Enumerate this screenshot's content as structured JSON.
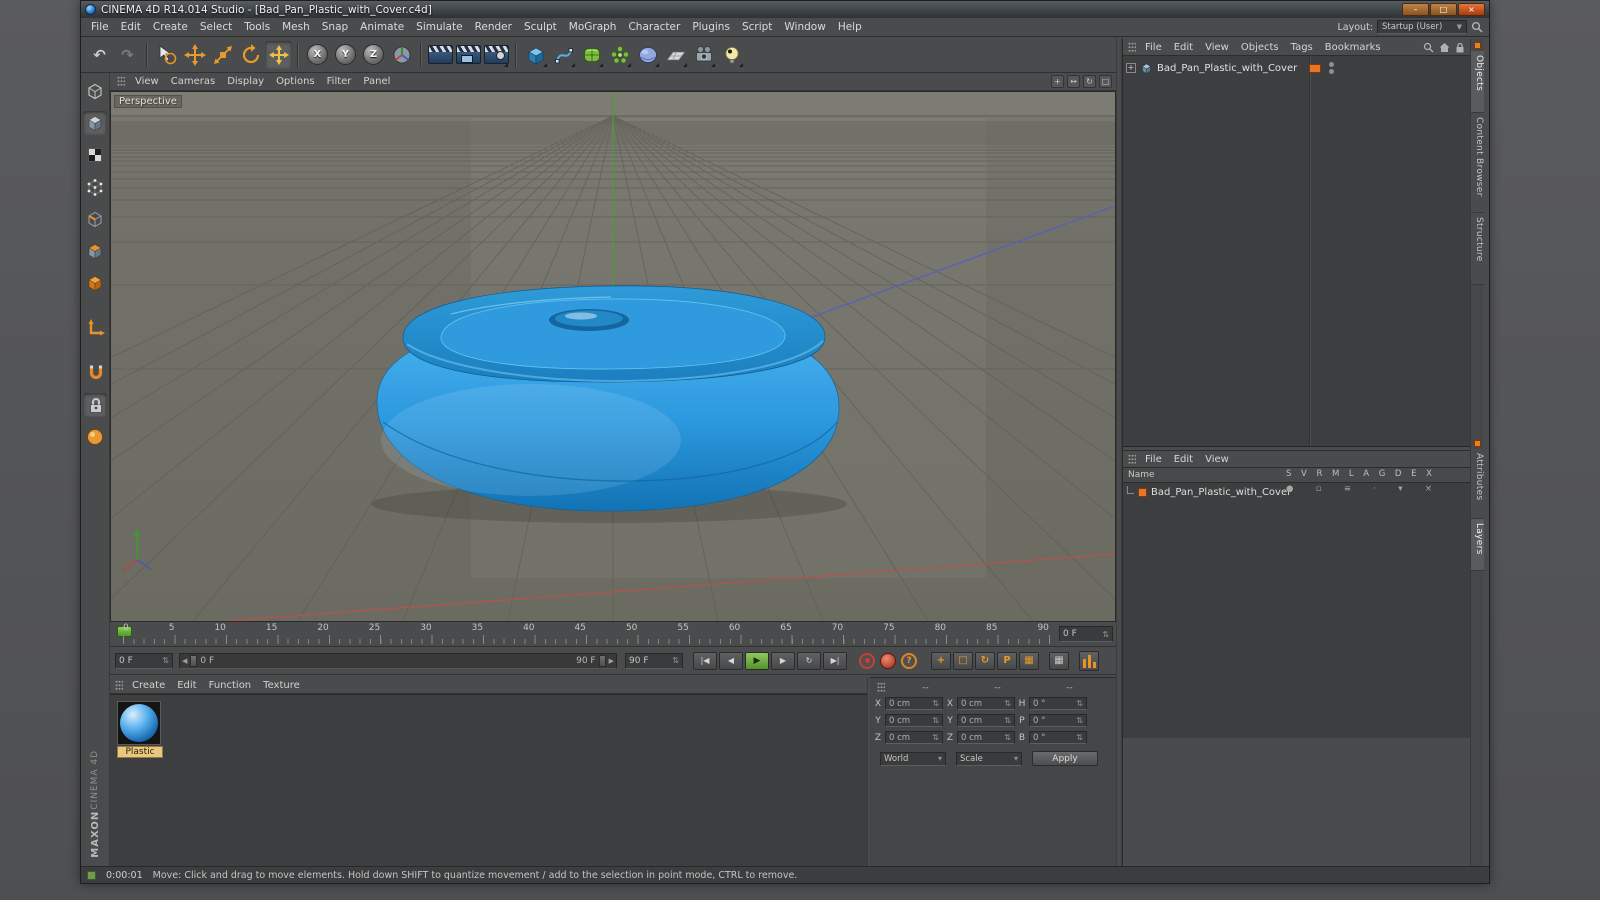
{
  "window": {
    "title": "CINEMA 4D R14.014 Studio - [Bad_Pan_Plastic_with_Cover.c4d]",
    "controls": {
      "minimize": "–",
      "maximize": "□",
      "close": "×"
    }
  },
  "menubar": {
    "items": [
      "File",
      "Edit",
      "Create",
      "Select",
      "Tools",
      "Mesh",
      "Snap",
      "Animate",
      "Simulate",
      "Render",
      "Sculpt",
      "MoGraph",
      "Character",
      "Plugins",
      "Script",
      "Window",
      "Help"
    ],
    "layout_label": "Layout:",
    "layout_value": "Startup (User)"
  },
  "toolbar": {
    "undo": "↶",
    "redo": "↷",
    "axis_x": "X",
    "axis_y": "Y",
    "axis_z": "Z"
  },
  "viewport": {
    "menu": [
      "View",
      "Cameras",
      "Display",
      "Options",
      "Filter",
      "Panel"
    ],
    "view_label": "Perspective",
    "corner_icons": [
      "+",
      "↔",
      "↻",
      "□"
    ]
  },
  "object_manager": {
    "menu": [
      "File",
      "Edit",
      "View",
      "Objects",
      "Tags",
      "Bookmarks"
    ],
    "expander_glyph": "+",
    "object_name": "Bad_Pan_Plastic_with_Cover"
  },
  "layer_manager": {
    "menu": [
      "File",
      "Edit",
      "View"
    ],
    "name_header": "Name",
    "columns": [
      "S",
      "V",
      "R",
      "M",
      "L",
      "A",
      "G",
      "D",
      "E",
      "X"
    ],
    "object_name": "Bad_Pan_Plastic_with_Cover",
    "row_icons": [
      "●",
      "▫",
      "≡",
      "·",
      "▾",
      "×"
    ]
  },
  "side_tabs": {
    "top": [
      "Objects",
      "Content Browser",
      "Structure"
    ],
    "bottom": [
      "Attributes",
      "Layers"
    ]
  },
  "timeline": {
    "ticks": [
      "0",
      "5",
      "10",
      "15",
      "20",
      "25",
      "30",
      "35",
      "40",
      "45",
      "50",
      "55",
      "60",
      "65",
      "70",
      "75",
      "80",
      "85",
      "90"
    ],
    "frame_field": "0 F",
    "current_field": "0 F",
    "range_start": "0 F",
    "range_end": "90 F",
    "end_field": "90 F",
    "range_left_arrow": "◀",
    "range_right_arrow": "▶",
    "spinner": "⇅",
    "buttons": {
      "goto_start": "|◀",
      "prev_frame": "◀",
      "play": "▶",
      "next_frame": "▶",
      "loop": "↻",
      "goto_end": "▶|"
    },
    "kf_icons": [
      "+",
      "□",
      "↻",
      "P",
      "▦"
    ],
    "grid_icon": "▦",
    "question": "?"
  },
  "material_manager": {
    "menu": [
      "Create",
      "Edit",
      "Function",
      "Texture"
    ],
    "material_name": "Plastic"
  },
  "coordinates": {
    "header_cols": [
      "--",
      "--",
      "--"
    ],
    "rows": [
      {
        "l1": "X",
        "v1": "0 cm",
        "l2": "X",
        "v2": "0 cm",
        "l3": "H",
        "v3": "0 °"
      },
      {
        "l1": "Y",
        "v1": "0 cm",
        "l2": "Y",
        "v2": "0 cm",
        "l3": "P",
        "v3": "0 °"
      },
      {
        "l1": "Z",
        "v1": "0 cm",
        "l2": "Z",
        "v2": "0 cm",
        "l3": "B",
        "v3": "0 °"
      }
    ],
    "mode_world": "World",
    "mode_scale": "Scale",
    "dropdown_arrow": "▾",
    "spinner": "⇅",
    "apply_label": "Apply"
  },
  "statusbar": {
    "time": "0:00:01",
    "message": "Move: Click and drag to move elements. Hold down SHIFT to quantize movement / add to the selection in point mode, CTRL to remove."
  },
  "branding": {
    "maxon": "MAXON",
    "product": "CINEMA 4D"
  }
}
